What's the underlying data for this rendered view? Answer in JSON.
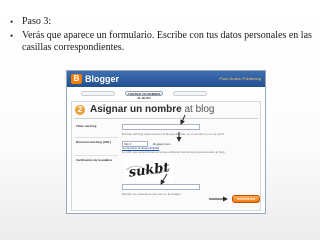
{
  "bullets": [
    "Paso 3:",
    "Verás que aparece un formulario. Escribe con tus datos personales en las casillas correspondientes."
  ],
  "screenshot": {
    "brand": "Blogger",
    "publisher": "Push-Button Publishing",
    "steps": {
      "active_label": "ASIGNAR UN NOMBRE AL BLOG"
    },
    "step_number": "2",
    "title_bold": "Asignar un nombre",
    "title_light": "at blog",
    "fields": {
      "blog_title_label": "Título del blog",
      "address_label": "Dirección del blog (URL)",
      "verification_label": "Verificación de la palabra",
      "url_prefix": "http://",
      "url_suffix": ".blogspot.com",
      "availability_link": "Comprobar la disponibilidad",
      "captcha_text": "sukbt"
    },
    "help_texts": {
      "title_help": "El título del blog aparecerá en el blog publicado, en el escritorio y en tu perfil.",
      "url_help": "La URL que seleccionas es la que utilizarán tus lectores para acceder al blog.",
      "captcha_help": "Escribe los caracteres que ves en la imagen."
    },
    "continue_label": "CONTINUAR",
    "colors": {
      "header": "#2f5f9f",
      "accent_orange": "#f07a10",
      "arrow": "#2a2a2a"
    }
  }
}
